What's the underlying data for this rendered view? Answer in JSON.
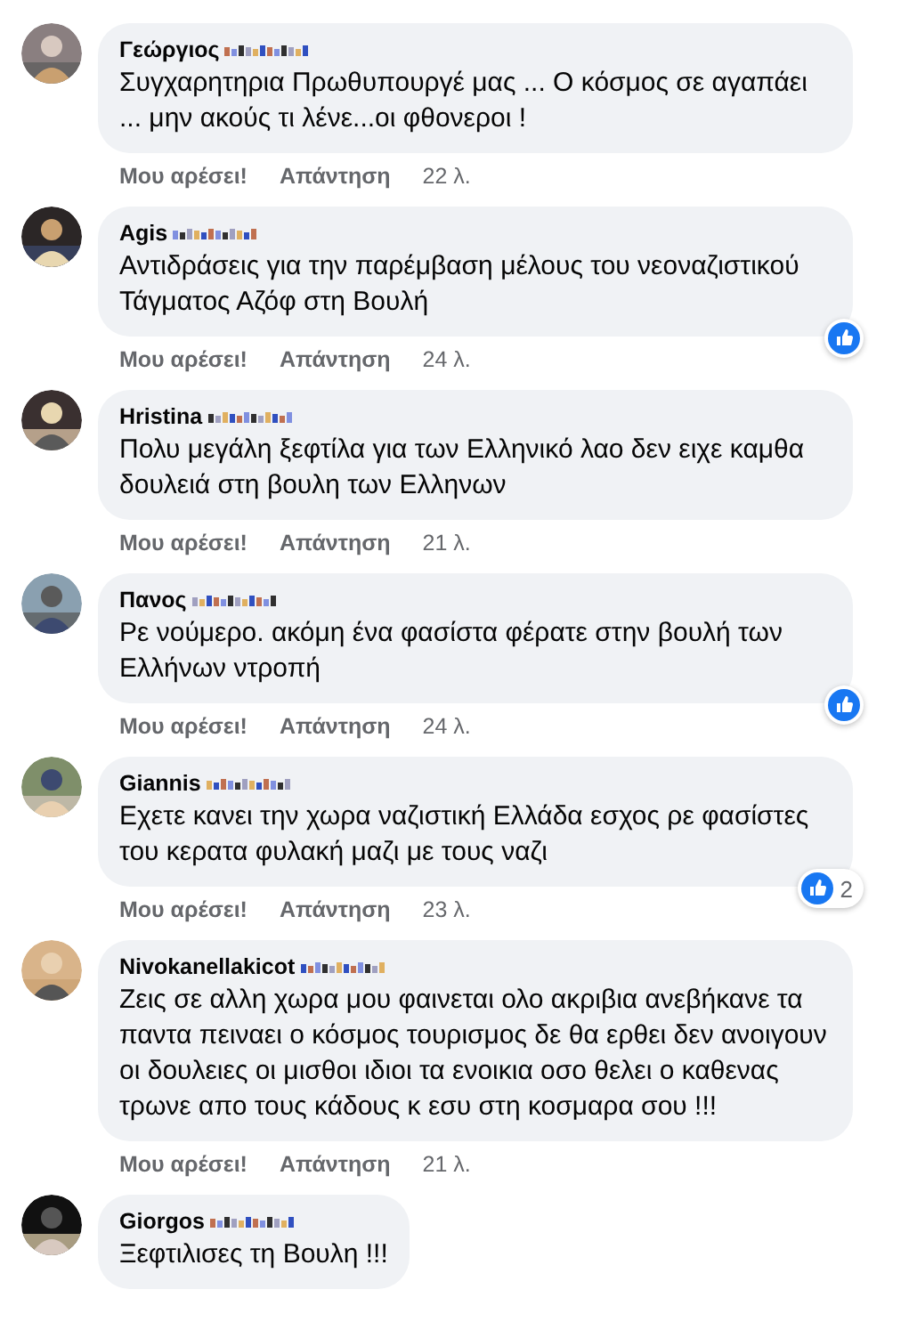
{
  "comments": [
    {
      "name": "Γεώργιος",
      "surname_redacted": true,
      "text": "Συγχαρητηρια Πρωθυπουργέ μας ... Ο κόσμος σε αγαπάει ... μην ακούς τι λένε...οι φθονεροι !",
      "like": "Μου αρέσει!",
      "reply": "Απάντηση",
      "time": "22 λ.",
      "reaction": false
    },
    {
      "name": "Agis",
      "surname_redacted": true,
      "text": "Αντιδράσεις για την παρέμβαση μέλους του νεοναζιστικού Τάγματος Αζόφ στη Βουλή",
      "like": "Μου αρέσει!",
      "reply": "Απάντηση",
      "time": "24 λ.",
      "reaction": true
    },
    {
      "name": "Hristina",
      "surname_redacted": true,
      "text": "Πολυ μεγάλη ξεφτίλα για των Ελληνικό λαο δεν ειχε καμθα δουλειά στη βουλη των Ελληνων",
      "like": "Μου αρέσει!",
      "reply": "Απάντηση",
      "time": "21 λ.",
      "reaction": false
    },
    {
      "name": "Πανος",
      "surname_redacted": true,
      "text": "Ρε νούμερο. ακόμη ένα φασίστα φέρατε στην βουλή των Ελλήνων ντροπή",
      "like": "Μου αρέσει!",
      "reply": "Απάντηση",
      "time": "24 λ.",
      "reaction": true
    },
    {
      "name": "Giannis",
      "surname_redacted": true,
      "text": "Εχετε κανει την χωρα ναζιστική Ελλάδα εσχος ρε φασίστες του κερατα φυλακή μαζι με τους ναζι",
      "like": "Μου αρέσει!",
      "reply": "Απάντηση",
      "time": "23 λ.",
      "reaction": true,
      "reaction_count": "2"
    },
    {
      "name": "Nivokanellakicot",
      "surname_redacted": true,
      "text": "Ζεις σε αλλη χωρα μου φαινεται ολο ακριβια ανεβήκανε τα παντα πειναει ο κόσμος τουρισμος δε θα ερθει δεν ανοιγουν οι δουλειες οι μισθοι ιδιοι τα ενοικια οσο θελει ο καθενας τρωνε απο τους κάδους κ εσυ στη κοσμαρα σου !!!",
      "like": "Μου αρέσει!",
      "reply": "Απάντηση",
      "time": "21 λ.",
      "reaction": false
    },
    {
      "name": "Giorgos",
      "surname_redacted": true,
      "text": "Ξεφτιλισες τη Βουλη !!!",
      "reaction": false
    }
  ]
}
